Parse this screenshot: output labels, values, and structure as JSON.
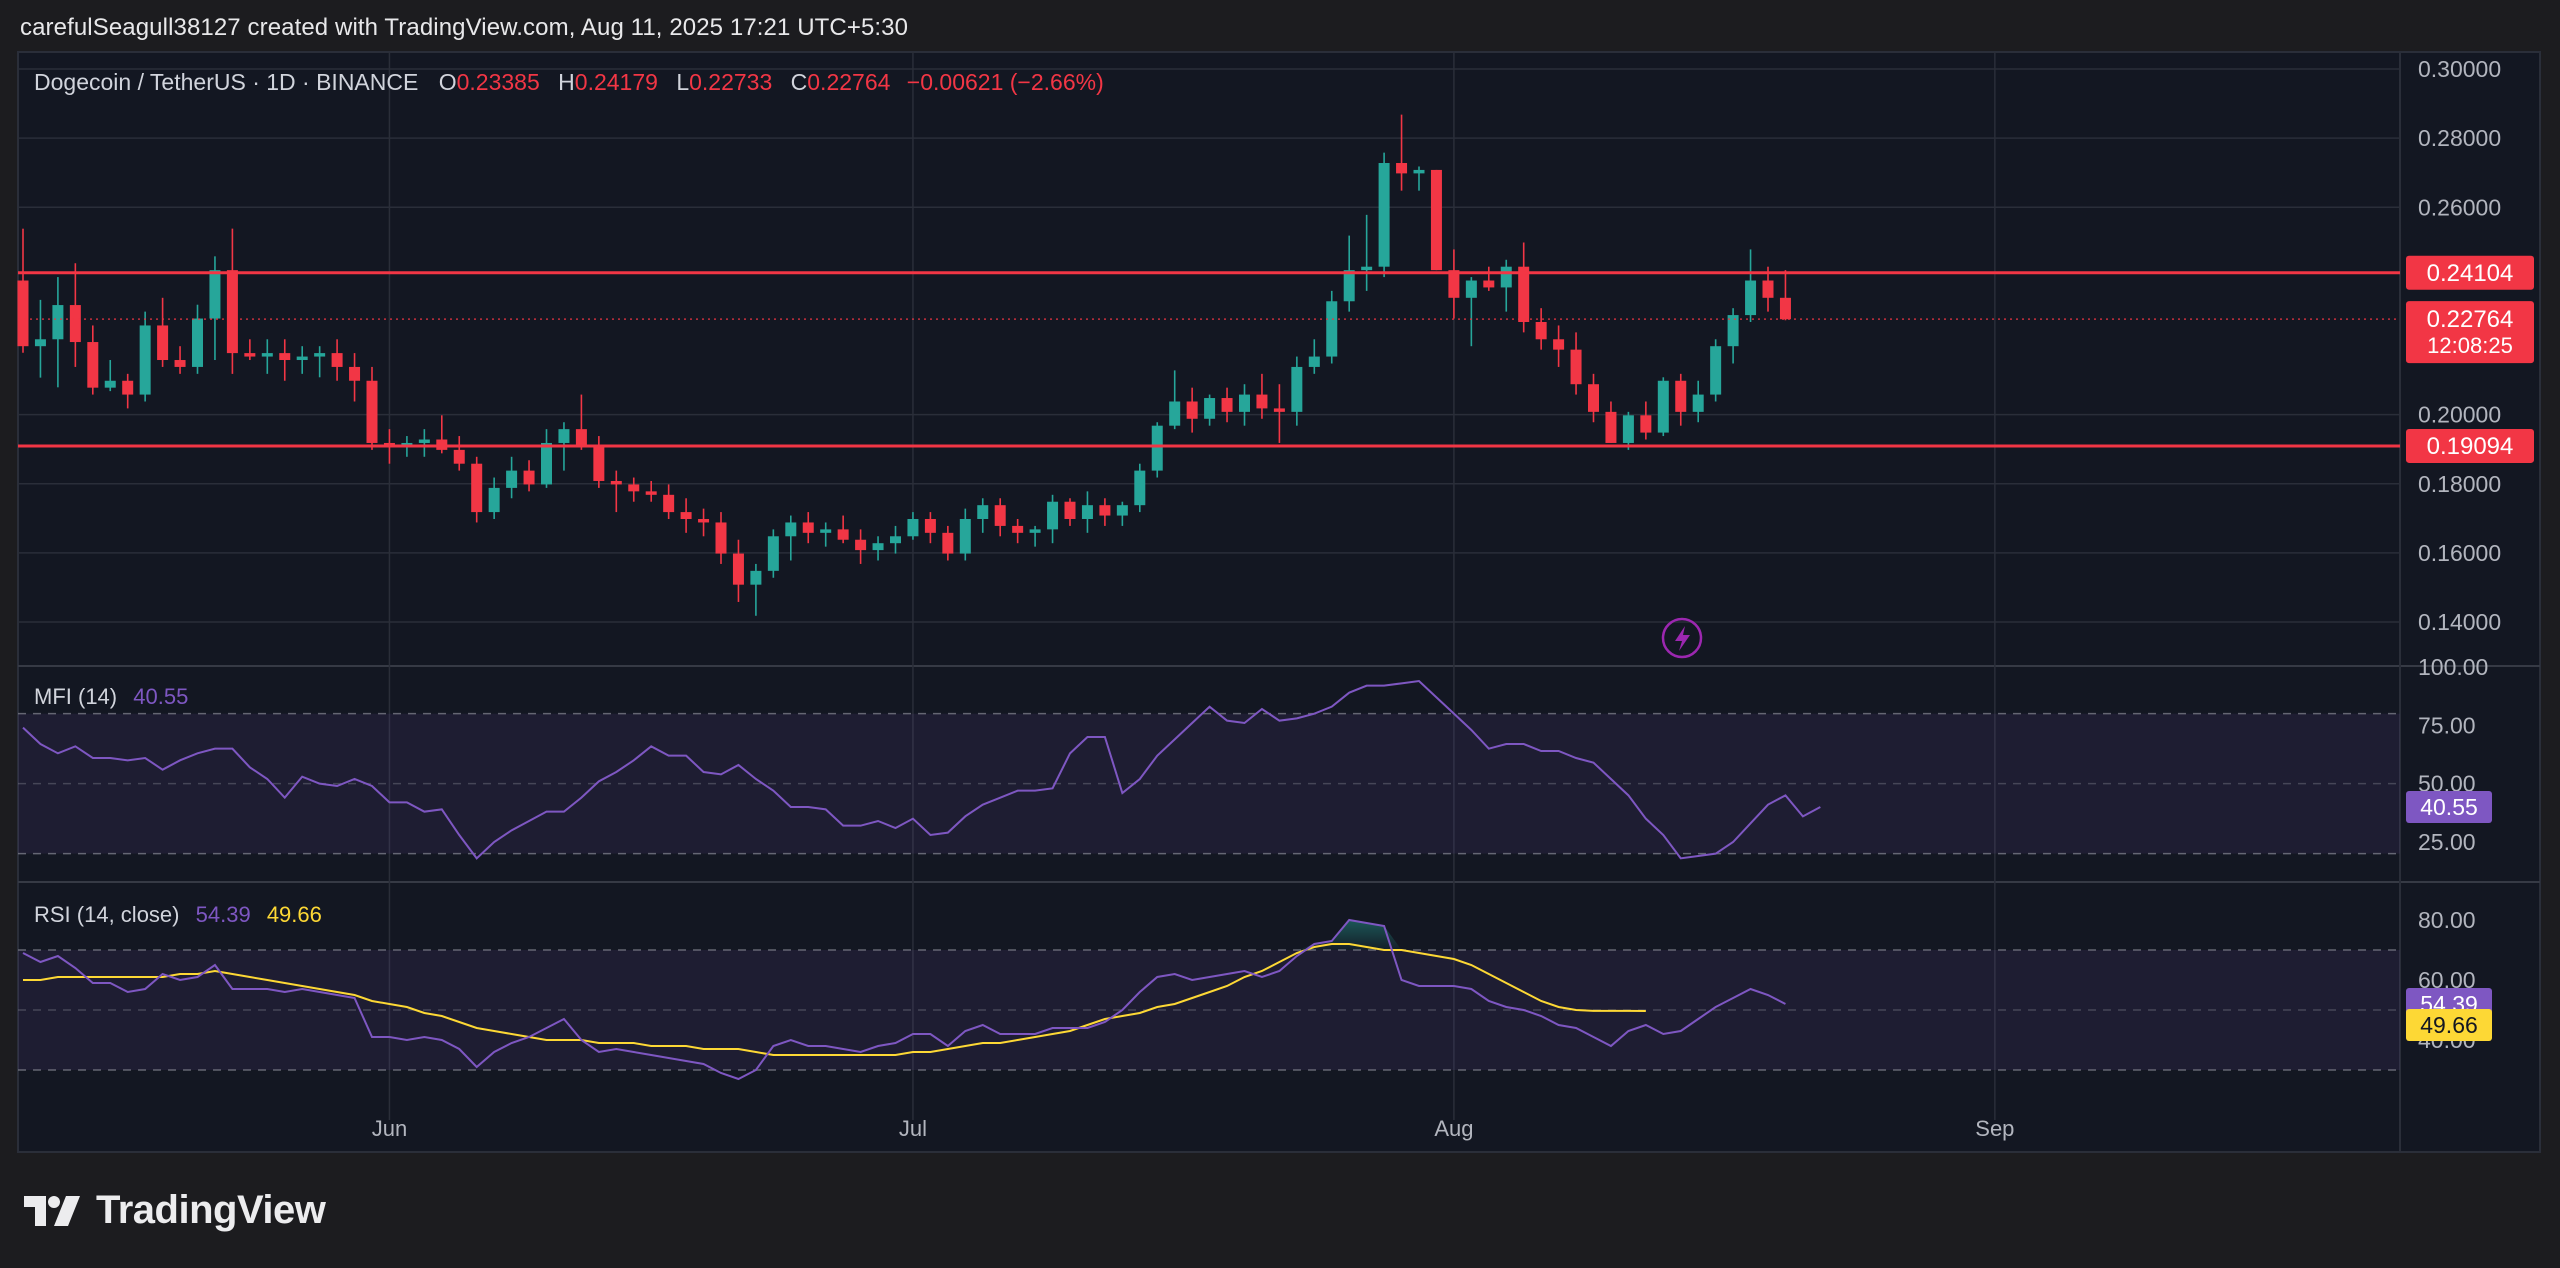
{
  "attribution": "carefulSeagull38127 created with TradingView.com, Aug 11, 2025 17:21 UTC+5:30",
  "brand": "TradingView",
  "legend": {
    "symbol": "Dogecoin / TetherUS · 1D · BINANCE",
    "o_label": "O",
    "o_value": "0.23385",
    "h_label": "H",
    "h_value": "0.24179",
    "l_label": "L",
    "l_value": "0.22733",
    "c_label": "C",
    "c_value": "0.22764",
    "change": "−0.00621 (−2.66%)"
  },
  "colors": {
    "up": "#26a69a",
    "down": "#f23645",
    "mfi": "#7e57c2",
    "rsi": "#7e57c2",
    "rsi_ma": "#fdd835",
    "level": "#f23645"
  },
  "chart_data": [
    {
      "type": "candlestick",
      "title": "Dogecoin / TetherUS · 1D · BINANCE",
      "ylim": [
        0.13,
        0.3
      ],
      "y_ticks": [
        "0.30000",
        "0.28000",
        "0.26000",
        "0.20000",
        "0.18000",
        "0.16000",
        "0.14000"
      ],
      "x_ticks": [
        {
          "label": "Jun",
          "date": "2025-06-01"
        },
        {
          "label": "Jul",
          "date": "2025-07-01"
        },
        {
          "label": "Aug",
          "date": "2025-08-01"
        },
        {
          "label": "Sep",
          "date": "2025-09-01"
        }
      ],
      "start_date": "2025-05-11",
      "candles": [
        [
          0.2388,
          0.2538,
          0.2179,
          0.2198
        ],
        [
          0.2198,
          0.2332,
          0.2107,
          0.2218
        ],
        [
          0.2218,
          0.2398,
          0.2079,
          0.2317
        ],
        [
          0.2317,
          0.2438,
          0.2138,
          0.221
        ],
        [
          0.221,
          0.2258,
          0.2058,
          0.2078
        ],
        [
          0.2078,
          0.2158,
          0.2068,
          0.2098
        ],
        [
          0.2098,
          0.2118,
          0.2018,
          0.2058
        ],
        [
          0.2058,
          0.2298,
          0.2038,
          0.2258
        ],
        [
          0.2258,
          0.2338,
          0.2138,
          0.2158
        ],
        [
          0.2158,
          0.2198,
          0.2118,
          0.2138
        ],
        [
          0.2138,
          0.2318,
          0.2118,
          0.2278
        ],
        [
          0.2278,
          0.2458,
          0.2158,
          0.2418
        ],
        [
          0.2418,
          0.2538,
          0.2118,
          0.2178
        ],
        [
          0.2178,
          0.2218,
          0.2158,
          0.2168
        ],
        [
          0.2168,
          0.2218,
          0.2118,
          0.2178
        ],
        [
          0.2178,
          0.2218,
          0.2098,
          0.2158
        ],
        [
          0.2158,
          0.2198,
          0.2118,
          0.2168
        ],
        [
          0.2168,
          0.2198,
          0.2108,
          0.2178
        ],
        [
          0.2178,
          0.2218,
          0.2098,
          0.2138
        ],
        [
          0.2138,
          0.2178,
          0.2038,
          0.2098
        ],
        [
          0.2098,
          0.2138,
          0.1898,
          0.1918
        ],
        [
          0.1918,
          0.1958,
          0.1858,
          0.1908
        ],
        [
          0.1908,
          0.1938,
          0.1878,
          0.1918
        ],
        [
          0.1918,
          0.1958,
          0.1878,
          0.1928
        ],
        [
          0.1928,
          0.1998,
          0.1888,
          0.1898
        ],
        [
          0.1898,
          0.1938,
          0.1838,
          0.1858
        ],
        [
          0.1858,
          0.1878,
          0.1688,
          0.1718
        ],
        [
          0.1718,
          0.1818,
          0.1698,
          0.1788
        ],
        [
          0.1788,
          0.1878,
          0.1758,
          0.1838
        ],
        [
          0.1838,
          0.1868,
          0.1778,
          0.1798
        ],
        [
          0.1798,
          0.1958,
          0.1788,
          0.1918
        ],
        [
          0.1918,
          0.1978,
          0.1838,
          0.1958
        ],
        [
          0.1958,
          0.2058,
          0.1898,
          0.1908
        ],
        [
          0.1908,
          0.1938,
          0.1788,
          0.1808
        ],
        [
          0.1808,
          0.1838,
          0.1718,
          0.1798
        ],
        [
          0.1798,
          0.1818,
          0.1748,
          0.1778
        ],
        [
          0.1778,
          0.1808,
          0.1748,
          0.1768
        ],
        [
          0.1768,
          0.1798,
          0.1698,
          0.1718
        ],
        [
          0.1718,
          0.1758,
          0.1658,
          0.1698
        ],
        [
          0.1698,
          0.1728,
          0.1648,
          0.1688
        ],
        [
          0.1688,
          0.1718,
          0.1568,
          0.1598
        ],
        [
          0.1598,
          0.1638,
          0.1458,
          0.1508
        ],
        [
          0.1508,
          0.1568,
          0.1418,
          0.1548
        ],
        [
          0.1548,
          0.1668,
          0.1528,
          0.1648
        ],
        [
          0.1648,
          0.1708,
          0.1578,
          0.1688
        ],
        [
          0.1688,
          0.1718,
          0.1628,
          0.1658
        ],
        [
          0.1658,
          0.1688,
          0.1618,
          0.1668
        ],
        [
          0.1668,
          0.1708,
          0.1628,
          0.1638
        ],
        [
          0.1638,
          0.1668,
          0.1568,
          0.1608
        ],
        [
          0.1608,
          0.1648,
          0.1578,
          0.1628
        ],
        [
          0.1628,
          0.1678,
          0.1598,
          0.1648
        ],
        [
          0.1648,
          0.1718,
          0.1638,
          0.1698
        ],
        [
          0.1698,
          0.1718,
          0.1628,
          0.1658
        ],
        [
          0.1658,
          0.1678,
          0.1578,
          0.1598
        ],
        [
          0.1598,
          0.1728,
          0.1578,
          0.1698
        ],
        [
          0.1698,
          0.1758,
          0.1658,
          0.1738
        ],
        [
          0.1738,
          0.1758,
          0.1648,
          0.1678
        ],
        [
          0.1678,
          0.1698,
          0.1628,
          0.1658
        ],
        [
          0.1658,
          0.1678,
          0.1618,
          0.1668
        ],
        [
          0.1668,
          0.1768,
          0.1628,
          0.1748
        ],
        [
          0.1748,
          0.1758,
          0.1678,
          0.1698
        ],
        [
          0.1698,
          0.1778,
          0.1658,
          0.1738
        ],
        [
          0.1738,
          0.1758,
          0.1678,
          0.1708
        ],
        [
          0.1708,
          0.1748,
          0.1678,
          0.1738
        ],
        [
          0.1738,
          0.1858,
          0.1718,
          0.1838
        ],
        [
          0.1838,
          0.1978,
          0.1818,
          0.1968
        ],
        [
          0.1968,
          0.2128,
          0.1958,
          0.2038
        ],
        [
          0.2038,
          0.2078,
          0.1948,
          0.1988
        ],
        [
          0.1988,
          0.2058,
          0.1968,
          0.2048
        ],
        [
          0.2048,
          0.2078,
          0.1978,
          0.2008
        ],
        [
          0.2008,
          0.2088,
          0.1968,
          0.2058
        ],
        [
          0.2058,
          0.2118,
          0.1988,
          0.2018
        ],
        [
          0.2018,
          0.2088,
          0.1918,
          0.2008
        ],
        [
          0.2008,
          0.2168,
          0.1968,
          0.2138
        ],
        [
          0.2138,
          0.2218,
          0.2118,
          0.2168
        ],
        [
          0.2168,
          0.2358,
          0.2148,
          0.2328
        ],
        [
          0.2328,
          0.2518,
          0.2298,
          0.2418
        ],
        [
          0.2418,
          0.2578,
          0.2358,
          0.2428
        ],
        [
          0.2428,
          0.2758,
          0.2398,
          0.2728
        ],
        [
          0.2728,
          0.2868,
          0.2648,
          0.2698
        ],
        [
          0.2698,
          0.2718,
          0.2648,
          0.2708
        ],
        [
          0.2708,
          0.2708,
          0.2418,
          0.2418
        ],
        [
          0.2418,
          0.2478,
          0.2278,
          0.2338
        ],
        [
          0.2338,
          0.2398,
          0.2198,
          0.2388
        ],
        [
          0.2388,
          0.2428,
          0.2358,
          0.2368
        ],
        [
          0.2368,
          0.2448,
          0.2298,
          0.2428
        ],
        [
          0.2428,
          0.2498,
          0.2238,
          0.2268
        ],
        [
          0.2268,
          0.2308,
          0.2188,
          0.2218
        ],
        [
          0.2218,
          0.2258,
          0.2138,
          0.2188
        ],
        [
          0.2188,
          0.2238,
          0.2058,
          0.2088
        ],
        [
          0.2088,
          0.2118,
          0.1978,
          0.2008
        ],
        [
          0.2008,
          0.2038,
          0.1918,
          0.1918
        ],
        [
          0.1918,
          0.2008,
          0.1898,
          0.1998
        ],
        [
          0.1998,
          0.2038,
          0.1928,
          0.1948
        ],
        [
          0.1948,
          0.2108,
          0.1938,
          0.2098
        ],
        [
          0.2098,
          0.2118,
          0.1968,
          0.2008
        ],
        [
          0.2008,
          0.2098,
          0.1978,
          0.2058
        ],
        [
          0.2058,
          0.2218,
          0.2038,
          0.2198
        ],
        [
          0.2198,
          0.2308,
          0.2148,
          0.2288
        ],
        [
          0.2288,
          0.2478,
          0.2268,
          0.2388
        ],
        [
          0.2388,
          0.2428,
          0.2298,
          0.2338
        ],
        [
          0.2338,
          0.2418,
          0.2273,
          0.2276
        ]
      ],
      "levels": [
        {
          "value": 0.24104,
          "label": "0.24104"
        },
        {
          "value": 0.19094,
          "label": "0.19094"
        }
      ],
      "last_price": {
        "value": 0.22764,
        "label": "0.22764",
        "countdown": "12:08:25"
      }
    },
    {
      "type": "line",
      "title": "MFI (14)",
      "value_label": "40.55",
      "ylim": [
        15,
        100
      ],
      "y_ticks": [
        "100.00",
        "75.00",
        "50.00",
        "25.00"
      ],
      "band": [
        20,
        80
      ],
      "mid": 50,
      "series": [
        {
          "name": "MFI (14)",
          "values": [
            74,
            67,
            63,
            66,
            61,
            61,
            60,
            61,
            56,
            60,
            63,
            65,
            65,
            57,
            52,
            44,
            53,
            50,
            49,
            52,
            49,
            42,
            42,
            38,
            39,
            28,
            18,
            25,
            30,
            34,
            38,
            38,
            44,
            51,
            55,
            60,
            66,
            62,
            62,
            55,
            54,
            58,
            52,
            47,
            40,
            40,
            39,
            32,
            32,
            34,
            31,
            35,
            28,
            29,
            36,
            41,
            44,
            47,
            47,
            48,
            63,
            70,
            70,
            46,
            52,
            62,
            69,
            76,
            83,
            77,
            76,
            82,
            77,
            78,
            80,
            83,
            89,
            92,
            92,
            93,
            94,
            87,
            80,
            73,
            65,
            67,
            67,
            64,
            64,
            61,
            59,
            52,
            45,
            35,
            28,
            18,
            19,
            20,
            25,
            33,
            41,
            45,
            36,
            40
          ]
        }
      ]
    },
    {
      "type": "line",
      "title": "RSI (14, close)",
      "value_label": "54.39",
      "ma_label": "49.66",
      "ylim": [
        25,
        90
      ],
      "y_ticks": [
        "80.00",
        "60.00",
        "40.00"
      ],
      "band": [
        30,
        70
      ],
      "mid": 50,
      "series": [
        {
          "name": "RSI (14, close)",
          "values": [
            69,
            66,
            68,
            64,
            59,
            59,
            56,
            57,
            62,
            60,
            61,
            65,
            57,
            57,
            57,
            56,
            57,
            56,
            55,
            54,
            41,
            41,
            40,
            41,
            40,
            37,
            31,
            36,
            39,
            41,
            44,
            47,
            40,
            36,
            37,
            36,
            35,
            34,
            33,
            32,
            29,
            27,
            30,
            38,
            40,
            38,
            38,
            37,
            36,
            38,
            39,
            42,
            42,
            38,
            43,
            45,
            42,
            42,
            42,
            44,
            44,
            44,
            46,
            50,
            56,
            61,
            62,
            60,
            61,
            62,
            63,
            61,
            63,
            68,
            72,
            73,
            80,
            79,
            78,
            60,
            58,
            58,
            58,
            57,
            53,
            51,
            50,
            48,
            45,
            44,
            41,
            38,
            43,
            45,
            42,
            43,
            47,
            51,
            54,
            57,
            55,
            52
          ]
        },
        {
          "name": "MA",
          "values": [
            60,
            60,
            61,
            61,
            61,
            61,
            61,
            61,
            61,
            62,
            62,
            63,
            62,
            61,
            60,
            59,
            58,
            57,
            56,
            55,
            53,
            52,
            51,
            49,
            48,
            46,
            44,
            43,
            42,
            41,
            40,
            40,
            40,
            39,
            39,
            39,
            38,
            38,
            38,
            37,
            37,
            37,
            36,
            35,
            35,
            35,
            35,
            35,
            35,
            35,
            35,
            36,
            36,
            37,
            38,
            39,
            39,
            40,
            41,
            42,
            43,
            45,
            47,
            48,
            49,
            51,
            52,
            54,
            56,
            58,
            61,
            63,
            66,
            69,
            71,
            72,
            72,
            71,
            70,
            70,
            69,
            68,
            67,
            65,
            62,
            59,
            56,
            53,
            51,
            50,
            49.7,
            49.7,
            49.7,
            49.66
          ]
        }
      ]
    }
  ]
}
